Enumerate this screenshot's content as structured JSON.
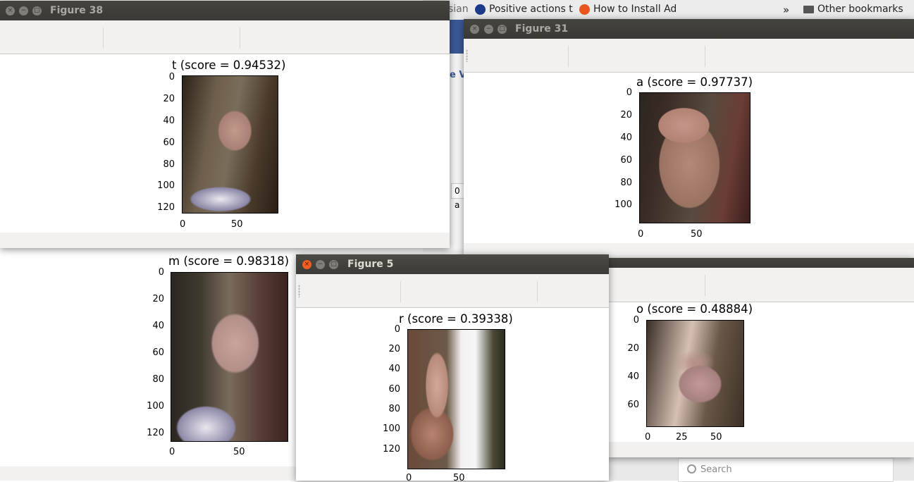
{
  "bookmarks": {
    "partial": "sian",
    "items": [
      {
        "label": "Positive actions t",
        "icon": "globe-icon",
        "color": "#1a3c8a"
      },
      {
        "label": "How to Install Ad",
        "icon": "ask-icon",
        "color": "#e8561d"
      }
    ],
    "overflow": "»",
    "other": "Other bookmarks"
  },
  "background_page": {
    "snippet1": "e Vi",
    "snippet2": "0 a"
  },
  "search": {
    "placeholder": "Search"
  },
  "windows": [
    {
      "id": "fig38",
      "title": "Figure 38",
      "active": false,
      "plot_title": "t (score = 0.94532)",
      "yticks": [
        "0",
        "20",
        "40",
        "60",
        "80",
        "100",
        "120"
      ],
      "xticks": [
        "0",
        "50"
      ]
    },
    {
      "id": "fig31",
      "title": "Figure 31",
      "active": false,
      "plot_title": "a (score = 0.97737)",
      "yticks": [
        "0",
        "20",
        "40",
        "60",
        "80",
        "100"
      ],
      "xticks": [
        "0",
        "50"
      ]
    },
    {
      "id": "figm",
      "title": "",
      "active": false,
      "plot_title": "m (score = 0.98318)",
      "yticks": [
        "0",
        "20",
        "40",
        "60",
        "80",
        "100",
        "120"
      ],
      "xticks": [
        "0",
        "50"
      ]
    },
    {
      "id": "figo",
      "title": "",
      "active": false,
      "plot_title": "o (score = 0.48884)",
      "yticks": [
        "0",
        "20",
        "40",
        "60"
      ],
      "xticks": [
        "0",
        "25",
        "50"
      ]
    },
    {
      "id": "fig5",
      "title": "Figure 5",
      "active": true,
      "plot_title": "r (score = 0.39338)",
      "yticks": [
        "0",
        "20",
        "40",
        "60",
        "80",
        "100",
        "120"
      ],
      "xticks": [
        "0",
        "50"
      ]
    }
  ],
  "colors": {
    "titlebar": "#3c3b37",
    "close_active": "#f15d22",
    "toolbar": "#f2f1f0",
    "skin": "#b88a7a",
    "dark": "#3a2c22"
  }
}
